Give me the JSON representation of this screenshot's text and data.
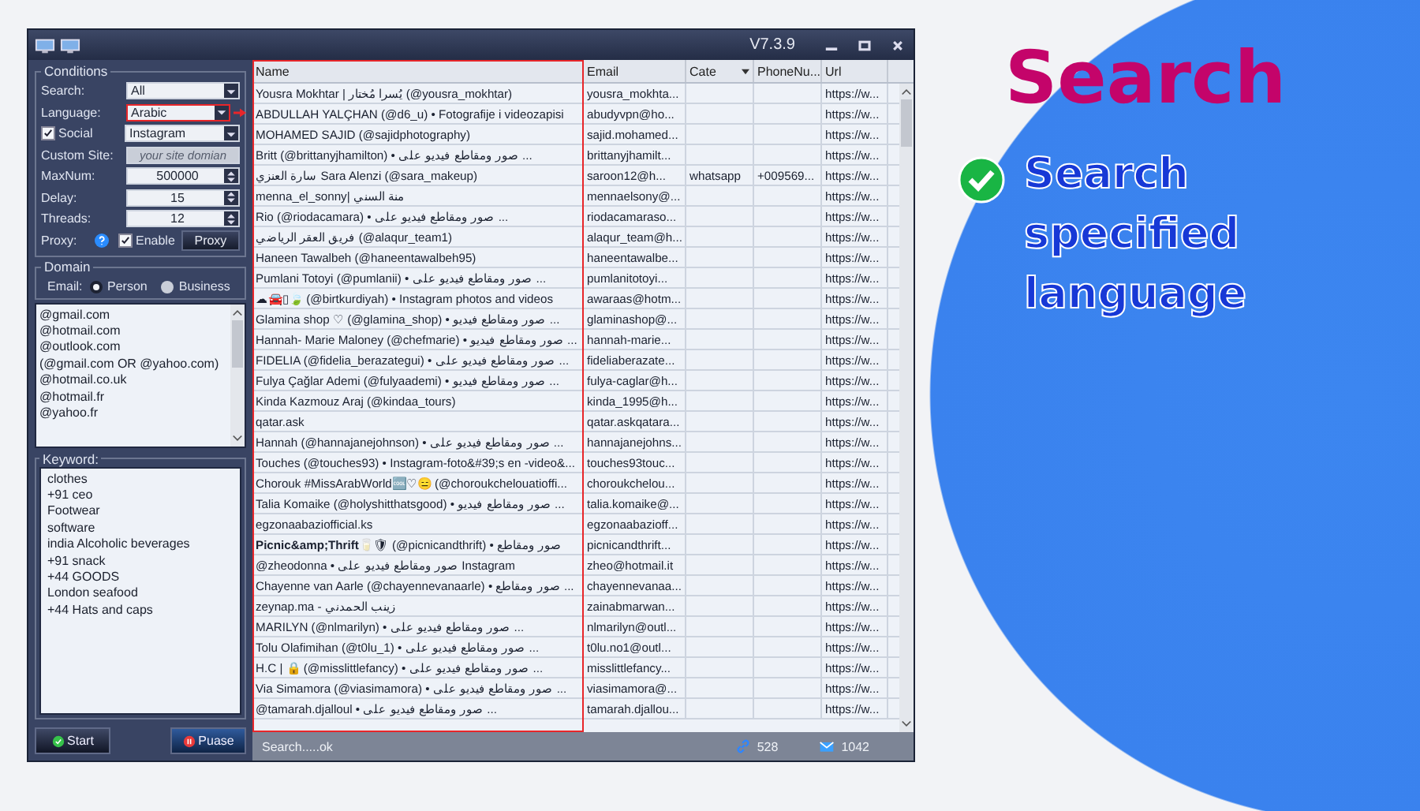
{
  "window": {
    "version": "V7.3.9"
  },
  "conditions": {
    "title": "Conditions",
    "fields": [
      {
        "kind": "select",
        "label": "Search:",
        "value": "All",
        "highlighted": false
      },
      {
        "kind": "select",
        "label": "Language:",
        "value": "Arabic",
        "highlighted": true
      },
      {
        "kind": "checkselect",
        "label": "Social",
        "checked": true,
        "value": "Instagram",
        "highlighted": false
      },
      {
        "kind": "text",
        "label": "Custom Site:",
        "placeholder": "your site domian",
        "highlighted": false
      },
      {
        "kind": "spin",
        "label": "MaxNum:",
        "value": "500000",
        "highlighted": false
      },
      {
        "kind": "spin",
        "label": "Delay:",
        "value": "15",
        "highlighted": false
      },
      {
        "kind": "spin",
        "label": "Threads:",
        "value": "12",
        "highlighted": false
      }
    ],
    "proxy": {
      "label": "Proxy:",
      "enable_label": "Enable",
      "enabled": true,
      "button": "Proxy"
    }
  },
  "domain": {
    "title": "Domain",
    "email_label": "Email:",
    "options": [
      {
        "label": "Person",
        "selected": true
      },
      {
        "label": "Business",
        "selected": false
      }
    ],
    "list": [
      "@gmail.com",
      "@hotmail.com",
      "@outlook.com",
      "(@gmail.com OR @yahoo.com)",
      "@hotmail.co.uk",
      "@hotmail.fr",
      "@yahoo.fr"
    ]
  },
  "keyword": {
    "title": "Keyword:",
    "items": [
      "clothes",
      "+91 ceo",
      "Footwear",
      "software",
      "india Alcoholic beverages",
      "+91 snack",
      "+44 GOODS",
      "London seafood",
      "+44 Hats and caps"
    ]
  },
  "buttons": {
    "start": "Start",
    "pause": "Puase"
  },
  "table": {
    "columns": [
      {
        "label": "Name",
        "highlighted": true
      },
      {
        "label": "Email",
        "highlighted": false
      },
      {
        "label": "Cate",
        "highlighted": false
      },
      {
        "label": "PhoneNu...",
        "highlighted": false
      },
      {
        "label": "Url",
        "highlighted": false
      }
    ],
    "rows": [
      {
        "name": "Yousra Mokhtar | يُسرا مُختار (@yousra_mokhtar)",
        "email": "yousra_mokhta...",
        "url": "https://w..."
      },
      {
        "name": "ABDULLAH YALÇHAN (@d6_u) • Fotografije i videozapisi",
        "email": "abudyvpn@ho...",
        "url": "https://w..."
      },
      {
        "name": "MOHAMED SAJID (@sajidphotography)",
        "email": "sajid.mohamed...",
        "url": "https://w..."
      },
      {
        "name": "Britt (@brittanyjhamilton) • صور ومقاطع فيديو على ...",
        "email": "brittanyjhamilt...",
        "url": "https://w..."
      },
      {
        "name": "سارة العنزي Sara Alenzi (@sara_makeup)",
        "email": "saroon12@h...",
        "cate": "whatsapp",
        "phone": "+009569...",
        "url": "https://w..."
      },
      {
        "name": "menna_el_sonny| منة السني",
        "email": "mennaelsony@...",
        "url": "https://w..."
      },
      {
        "name": "Rio (@riodacamara) • صور ومقاطع فيديو على ...",
        "email": "riodacamaraso...",
        "url": "https://w..."
      },
      {
        "name": "فريق العقر الرياضي (@alaqur_team1)",
        "email": "alaqur_team@h...",
        "url": "https://w..."
      },
      {
        "name": "Haneen Tawalbeh (@haneentawalbeh95)",
        "email": "haneentawalbe...",
        "url": "https://w..."
      },
      {
        "name": "Pumlani Totoyi (@pumlanii) • صور ومقاطع فيديو على ...",
        "email": "pumlanitotoyi...",
        "url": "https://w..."
      },
      {
        "name": "☁🚘▯🍃 (@birtkurdiyah) • Instagram photos and videos",
        "email": "awaraas@hotm...",
        "url": "https://w..."
      },
      {
        "name": "Glamina shop ♡ (@glamina_shop) • صور ومقاطع فيديو ...",
        "email": "glaminashop@...",
        "url": "https://w..."
      },
      {
        "name": "Hannah- Marie Maloney (@chefmarie) • صور ومقاطع فيديو ...",
        "email": "hannah-marie...",
        "url": "https://w..."
      },
      {
        "name": "FIDELIA (@fidelia_berazategui) • صور ومقاطع فيديو على ...",
        "email": "fideliaberazate...",
        "url": "https://w..."
      },
      {
        "name": "Fulya Çağlar Ademi (@fulyaademi) • صور ومقاطع فيديو ...",
        "email": "fulya-caglar@h...",
        "url": "https://w..."
      },
      {
        "name": "Kinda Kazmouz Araj (@kindaa_tours)",
        "email": "kinda_1995@h...",
        "url": "https://w..."
      },
      {
        "name": "qatar.ask",
        "email": "qatar.askqatara...",
        "url": "https://w..."
      },
      {
        "name": "Hannah (@hannajanejohnson) • صور ومقاطع فيديو على ...",
        "email": "hannajanejohns...",
        "url": "https://w..."
      },
      {
        "name": "Touches (@touches93) • Instagram-foto&#39;s en -video&...",
        "email": "touches93touc...",
        "url": "https://w..."
      },
      {
        "name": "Chorouk #MissArabWorld🆒♡😑 (@choroukchelouatioffi...",
        "email": "choroukchelou...",
        "url": "https://w..."
      },
      {
        "name": "Talia Komaike (@holyshitthatsgood) • صور ومقاطع فيديو ...",
        "email": "talia.komaike@...",
        "url": "https://w..."
      },
      {
        "name": "egzonaabaziofficial.ks",
        "email": "egzonaabazioff...",
        "url": "https://w..."
      },
      {
        "name": "**Picnic&amp;Thrift**🥛🛡 (@picnicandthrift) • صور ومقاطع",
        "email": "picnicandthrift...",
        "url": "https://w..."
      },
      {
        "name": "@zheodonna • صور ومقاطع فيديو على Instagram",
        "email": "zheo@hotmail.it",
        "url": "https://w..."
      },
      {
        "name": "Chayenne van Aarle (@chayennevanaarle) • صور ومقاطع ...",
        "email": "chayennevanaa...",
        "url": "https://w..."
      },
      {
        "name": "zeynap.ma - زينب الحمدني",
        "email": "zainabmarwan...",
        "url": "https://w..."
      },
      {
        "name": "MARILYN (@nlmarilyn) • صور ومقاطع فيديو على ...",
        "email": "nlmarilyn@outl...",
        "url": "https://w..."
      },
      {
        "name": "Tolu Olafimihan (@t0lu_1) • صور ومقاطع فيديو على ...",
        "email": "t0lu.no1@outl...",
        "url": "https://w..."
      },
      {
        "name": "H.C | 🔒 (@misslittlefancy) • صور ومقاطع فيديو على ...",
        "email": "misslittlefancy...",
        "url": "https://w..."
      },
      {
        "name": "Via Simamora (@viasimamora) • صور ومقاطع فيديو على ...",
        "email": "viasimamora@...",
        "url": "https://w..."
      },
      {
        "name": "@tamarah.djalloul • صور ومقاطع فيديو على ...",
        "email": "tamarah.djallou...",
        "url": "https://w..."
      }
    ]
  },
  "status": {
    "text": "Search.....ok",
    "links": "528",
    "emails": "1042"
  },
  "promo": {
    "title": "Search",
    "feature": "Search specified language"
  }
}
